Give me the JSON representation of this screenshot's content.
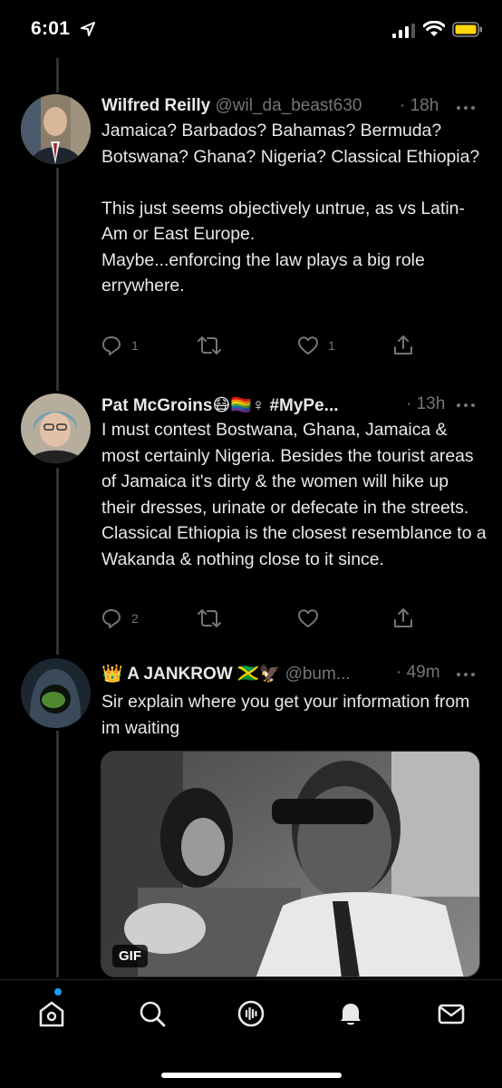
{
  "status_bar": {
    "time": "6:01"
  },
  "tweets": [
    {
      "name": "Wilfred Reilly",
      "handle": "@wil_da_beast630",
      "time": "· 18h",
      "text": "Jamaica? Barbados? Bahamas? Bermuda? Botswana? Ghana? Nigeria? Classical Ethiopia?\n\nThis just seems objectively untrue, as vs Latin-Am or East Europe.\nMaybe...enforcing the law plays a big role errywhere.",
      "replies": "1",
      "retweets": "",
      "likes": "1"
    },
    {
      "name": "Pat McGroins😷🏳️‍🌈♀ #MyPe...",
      "handle": "",
      "time": "· 13h",
      "text": "I must contest Bostwana, Ghana, Jamaica & most certainly Nigeria. Besides the tourist areas of Jamaica it's dirty & the women will hike up their dresses, urinate or defecate in the streets. Classical Ethiopia is the closest resemblance to a Wakanda & nothing close to it since.",
      "replies": "2",
      "retweets": "",
      "likes": ""
    },
    {
      "name": "👑 A JANKROW 🇯🇲🦅",
      "handle": "@bum...",
      "time": "· 49m",
      "text": "Sir explain where you get your information from im waiting",
      "media_badge": "GIF"
    }
  ],
  "tabbar": {
    "tabs": [
      "home-icon",
      "search-icon",
      "spaces-icon",
      "notifications-icon",
      "messages-icon"
    ],
    "accent": "#1d9bf0"
  }
}
